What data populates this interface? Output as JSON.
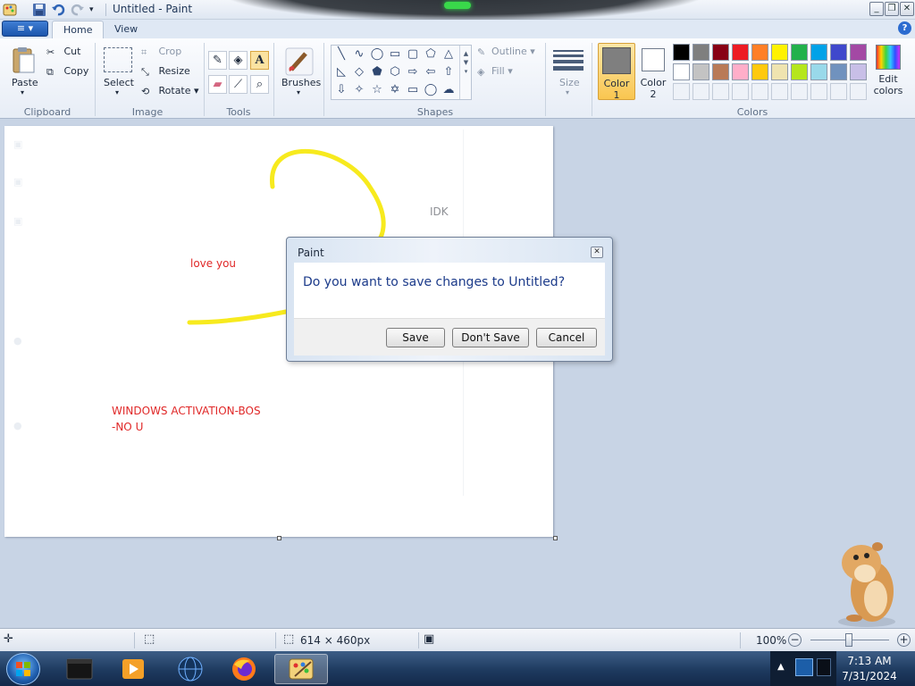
{
  "window": {
    "title": "Untitled - Paint",
    "controls": [
      "minimize",
      "restore",
      "close"
    ]
  },
  "quick_access": [
    "paint-app-icon",
    "save-icon",
    "undo-icon",
    "redo-icon",
    "customize-dropdown-icon"
  ],
  "tabs": [
    {
      "label": "Home",
      "active": true
    },
    {
      "label": "View",
      "active": false
    }
  ],
  "ribbon": {
    "clipboard": {
      "label": "Clipboard",
      "paste": "Paste",
      "cut": "Cut",
      "copy": "Copy"
    },
    "image": {
      "label": "Image",
      "select": "Select",
      "crop": "Crop",
      "resize": "Resize",
      "rotate": "Rotate"
    },
    "tools": {
      "label": "Tools",
      "items": [
        "pencil-icon",
        "fill-icon",
        "text-icon",
        "eraser-icon",
        "color-picker-icon",
        "magnifier-icon"
      ]
    },
    "brushes": {
      "label": "Brushes"
    },
    "shapes": {
      "label": "Shapes",
      "outline": "Outline",
      "fill": "Fill"
    },
    "size": {
      "label": "Size"
    },
    "colors": {
      "label": "Colors",
      "color1": {
        "label_line1": "Color",
        "label_line2": "1",
        "value": "#7f7f7f"
      },
      "color2": {
        "label_line1": "Color",
        "label_line2": "2",
        "value": "#ffffff"
      },
      "edit": {
        "line1": "Edit",
        "line2": "colors"
      },
      "palette_row1": [
        "#000000",
        "#7f7f7f",
        "#880015",
        "#ed1c24",
        "#ff7f27",
        "#fff200",
        "#22b14c",
        "#00a2e8",
        "#3f48cc",
        "#a349a4"
      ],
      "palette_row2": [
        "#ffffff",
        "#c3c3c3",
        "#b97a57",
        "#ffaec9",
        "#ffc90e",
        "#efe4b0",
        "#b5e61d",
        "#99d9ea",
        "#7092be",
        "#c8bfe7"
      ]
    }
  },
  "canvas": {
    "texts": {
      "love": "love you",
      "idk": "IDK",
      "activation1": "WINDOWS ACTIVATION-BOS",
      "activation2": "-NO U"
    },
    "text_color_red": "#e02828",
    "stroke_color": "#f7ea1e"
  },
  "dialog": {
    "title": "Paint",
    "message": "Do you want to save changes to Untitled?",
    "buttons": {
      "save": "Save",
      "dont_save": "Don't Save",
      "cancel": "Cancel"
    }
  },
  "status": {
    "dimensions": "614 × 460px",
    "zoom": "100%"
  },
  "taskbar": {
    "apps": [
      "terminal-icon",
      "media-player-icon",
      "globe-icon",
      "firefox-icon",
      "paint-icon"
    ],
    "time": "7:13 AM",
    "date": "7/31/2024"
  }
}
